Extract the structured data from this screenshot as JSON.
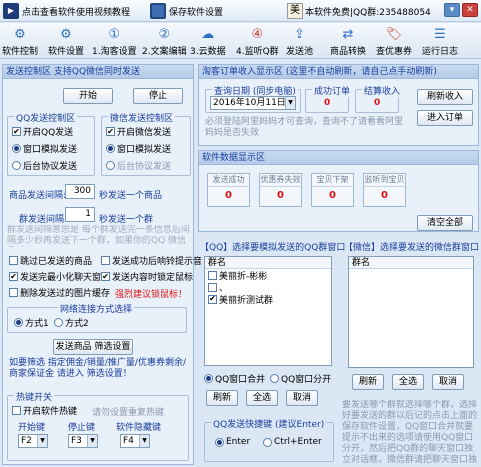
{
  "topbar": {
    "tutorial_label": "点击查看软件使用视频教程",
    "save_label": "保存软件设置",
    "free_text": "本软件免费|QQ群:235488054",
    "min": "▾",
    "max": "—",
    "close": "✕"
  },
  "toolbar": {
    "items": [
      "软件控制",
      "软件设置",
      "1.淘客设置",
      "2.文案编辑",
      "3.云数据",
      "4.监听Q群",
      "发送池",
      "商品转换",
      "查优惠券",
      "运行日志"
    ],
    "icons": [
      "gear-icon",
      "gear-icon",
      "num-1-icon",
      "num-2-icon",
      "num-3-icon",
      "num-4-icon",
      "pool-icon",
      "convert-icon",
      "coupon-icon",
      "log-icon"
    ]
  },
  "send_ctrl": {
    "title": "发送控制区  支持QQ微信同时发送",
    "start": "开始",
    "stop": "停止",
    "qq_group": {
      "title": "QQ发送控制区",
      "enable": "开启QQ发送",
      "window_mode": "窗口模拟发送",
      "protocol_mode": "后台协议发送"
    },
    "wx_group": {
      "title": "微信发送控制区",
      "enable": "开启微信发送",
      "window_mode": "窗口模拟发送",
      "protocol_mode": "后台协议发送"
    },
    "goods_interval_label": "商品发送间隔:",
    "goods_interval_value": "300",
    "goods_interval_suffix": "秒发送一个商品",
    "group_interval_label": "群发送间隔:",
    "group_interval_value": "1",
    "group_interval_suffix": "秒发送一个群",
    "overlay_note": "群发送间隔意思是 每个群发送完一条信息后间隔多少秒再发送下一个群，如果你的QQ 微信号够多",
    "opt_skip_sent": "跳过已发送的商品",
    "opt_after_send_tip": "发送成功后响铃提示音",
    "opt_minimize": "发送完最小化聊天窗口",
    "opt_lock_mouse": "发送内容时锁定鼠标",
    "opt_delete_cache": "删除发送过的图片缓存",
    "strong_tip": "强烈建议锁鼠标！",
    "net_group": {
      "title": "网络连接方式选择",
      "mode1": "方式1",
      "mode2": "方式2"
    },
    "filter_btn": "发送商品 筛选设置",
    "filter_note": "如要筛选 指定佣金/销量/推广量/优惠券剩余/商家保证金 请进入 筛选设置！",
    "hotkey": {
      "title": "热键开关",
      "enable": "开启软件热键",
      "hint": "请勿设置重复热键",
      "start_label": "开始键",
      "start_val": "F2",
      "stop_label": "停止键",
      "stop_val": "F3",
      "hide_label": "软件隐藏键",
      "hide_val": "F4"
    }
  },
  "taoke": {
    "title": "淘客订单收入显示区 (这里不自动刷新，请自己点手动刷新)",
    "date_label": "查询日期 (同步电脑)",
    "date_value": "2016年10月11日",
    "success_label": "成功订单",
    "success_value": "0",
    "settle_label": "结算收入",
    "settle_value": "0",
    "refresh": "刷新收入",
    "enter_order": "进入订单",
    "note": "必须登陆阿里妈妈才可查询，查询不了请看看阿里妈妈是否失效"
  },
  "data_panel": {
    "title": "软件数据显示区",
    "stats": [
      {
        "label": "发送成功",
        "value": "0"
      },
      {
        "label": "优惠券失效",
        "value": "0"
      },
      {
        "label": "宝贝下架",
        "value": "0"
      },
      {
        "label": "监听到宝贝",
        "value": "0"
      }
    ],
    "clear_all": "清空全部"
  },
  "qq_groups": {
    "title": "【QQ】选择要模拟发送的QQ群窗口",
    "col": "群名",
    "rows": [
      "美丽折-彬彬",
      "、",
      "美丽折测试群"
    ],
    "checked": [
      false,
      false,
      true
    ],
    "merge": "QQ窗口合并",
    "split": "QQ窗口分开",
    "refresh": "刷新",
    "select_all": "全选",
    "cancel": "取消"
  },
  "wx_groups": {
    "title": "【微信】选择要发送的微信群窗口",
    "col": "群名",
    "refresh": "刷新",
    "select_all": "全选",
    "cancel": "取消"
  },
  "send_shortcut": {
    "title": "QQ发送快捷键 (建议Enter)",
    "enter": "Enter",
    "ctrl_enter": "Ctrl+Enter"
  },
  "bottom_note": "要发送哪个群就选择哪个群，选择好要发送的群以后记的点击上面的保存软件设置，QQ窗口合并就要提示不出来的选项请使用QQ窗口分开，然后把QQ群的聊天窗口独立对话框，微信群请把聊天窗口独立拖出来，不懂请看教程"
}
